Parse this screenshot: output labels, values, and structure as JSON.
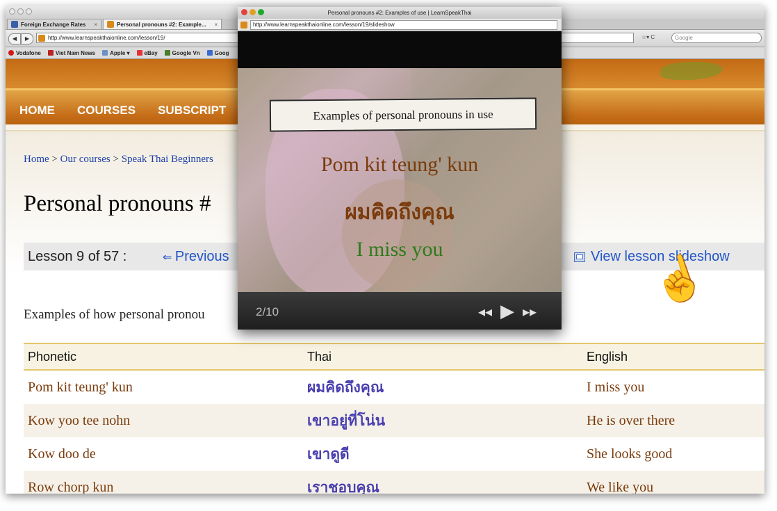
{
  "browser": {
    "tabs": [
      {
        "label": "Foreign Exchange Rates",
        "close": "×"
      },
      {
        "label": "Personal pronouns #2: Example...",
        "close": "×"
      }
    ],
    "url": "http://www.learnspeakthaionline.com/lesson/19/",
    "search_placeholder": "Google",
    "bookmarks": [
      "Vodafone",
      "Viet Nam News",
      "Apple ▾",
      "eBay",
      "Google Vn",
      "Goog"
    ]
  },
  "site": {
    "menu": [
      "HOME",
      "COURSES",
      "SUBSCRIPT"
    ],
    "breadcrumb": [
      "Home",
      "Our courses",
      "Speak Thai Beginners"
    ],
    "breadcrumb_sep": ">",
    "page_title": "Personal pronouns #",
    "lesson_label": "Lesson 9 of 57 :",
    "previous_label": "Previous",
    "slideshow_label": "View lesson slideshow",
    "intro": "Examples of how personal pronou",
    "table": {
      "headers": [
        "Phonetic",
        "Thai",
        "English"
      ],
      "rows": [
        {
          "phonetic": "Pom kit teung' kun",
          "thai": "ผมคิดถึงคุณ",
          "english": "I miss you"
        },
        {
          "phonetic": "Kow yoo tee nohn",
          "thai": "เขาอยู่ที่โน่น",
          "english": "He is over there"
        },
        {
          "phonetic": "Kow doo de",
          "thai": "เขาดูดี",
          "english": "She looks good"
        },
        {
          "phonetic": "Row chorp kun",
          "thai": "เราชอบคุณ",
          "english": "We like you"
        }
      ]
    }
  },
  "popup": {
    "title": "Personal pronouns #2: Examples of use | LearnSpeakThai",
    "url": "http://www.learnspeakthaionline.com/lesson/19/slideshow",
    "caption": "Examples of personal pronouns in use",
    "phonetic": "Pom kit teung' kun",
    "thai": "ผมคิดถึงคุณ",
    "english": "I miss you",
    "counter": "2/10"
  },
  "colors": {
    "brown": "#7a3b0c",
    "green": "#2e7a1b",
    "blue": "#2f2fb8",
    "link": "#2255c6",
    "header_orange": "#c56d18"
  }
}
